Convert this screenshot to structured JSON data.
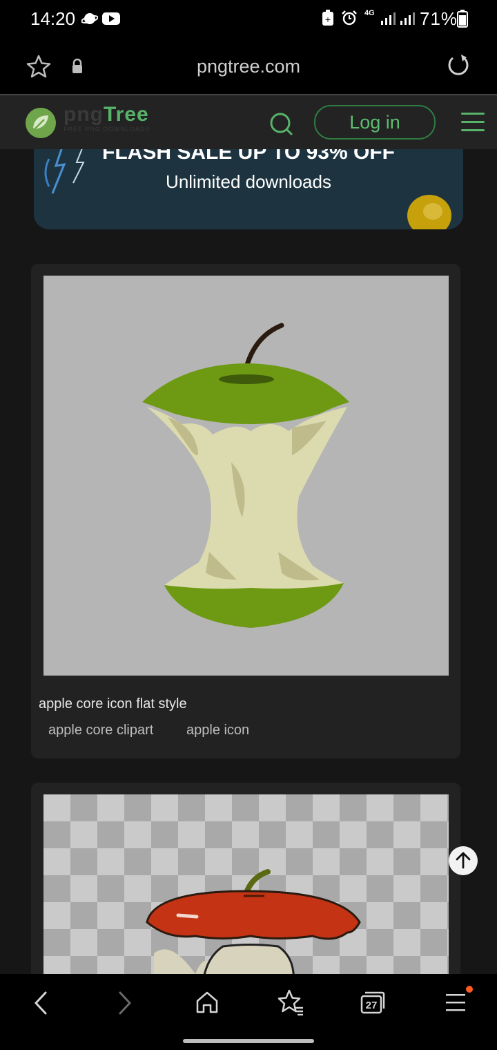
{
  "status_bar": {
    "time": "14:20",
    "battery_text": "71%",
    "network": "4G"
  },
  "address_bar": {
    "url": "pngtree.com"
  },
  "site_header": {
    "logo_png": "png",
    "logo_tree": "Tree",
    "logo_subtitle": "FREE PNG DOWNLOADS",
    "login_label": "Log in"
  },
  "banner": {
    "headline": "FLASH SALE UP TO 93% OFF",
    "subline": "Unlimited downloads"
  },
  "results": [
    {
      "caption": "apple core icon flat style",
      "tags": [
        "apple core clipart",
        "apple icon"
      ]
    }
  ],
  "bottom_nav": {
    "tabs_count": "27"
  },
  "colors": {
    "accent_green": "#58b36a",
    "banner_bg": "#1d3440",
    "notification_dot": "#ff5a1f"
  }
}
